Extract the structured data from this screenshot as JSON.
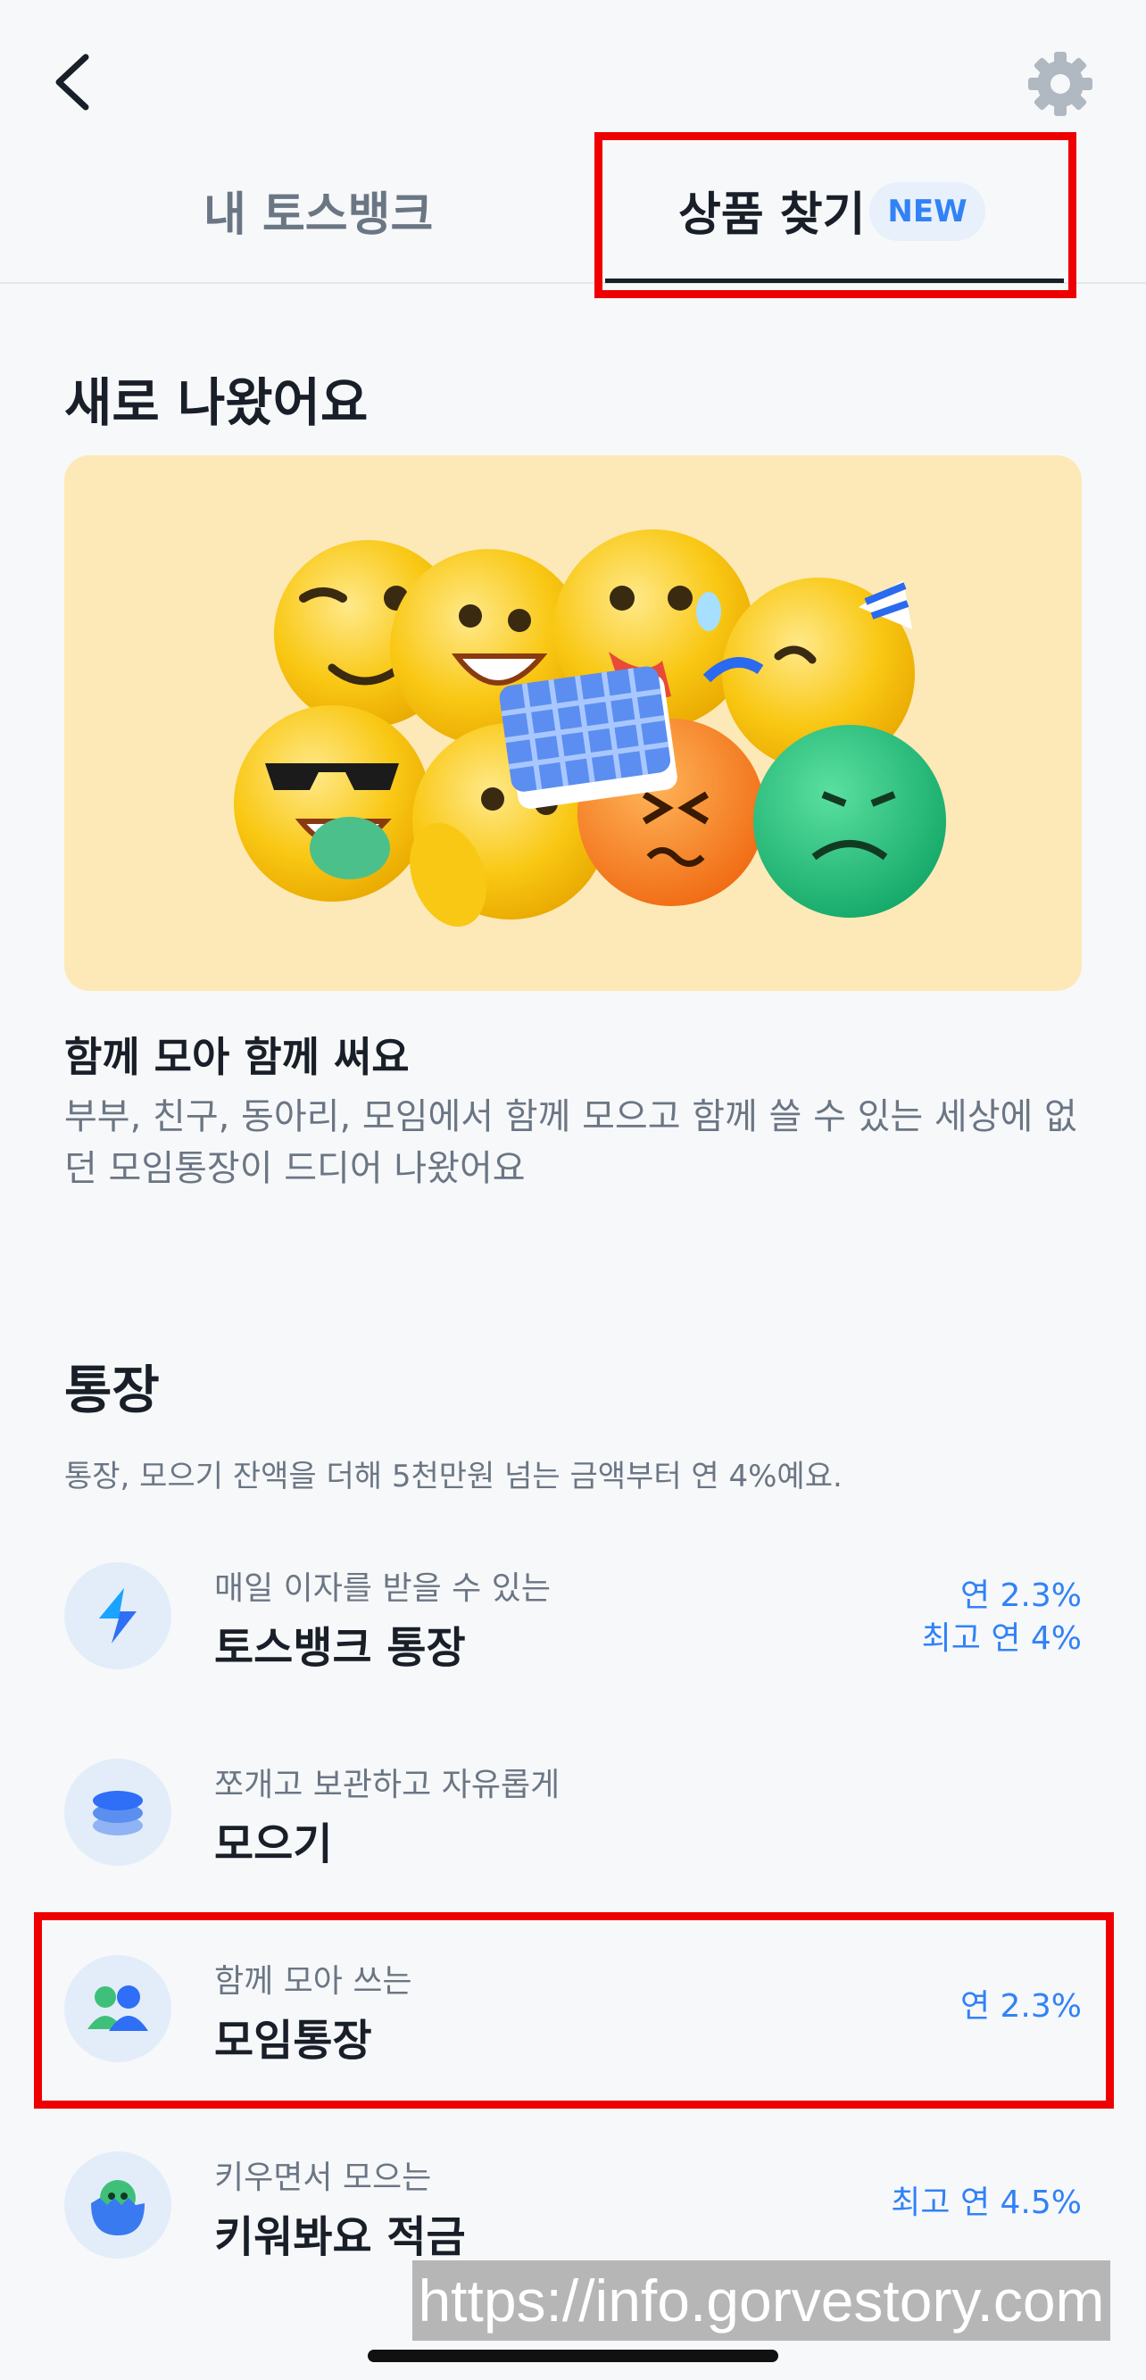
{
  "header": {
    "tabs": [
      {
        "label": "내 토스뱅크",
        "selected": false
      },
      {
        "label": "상품 찾기",
        "selected": true,
        "badge": "NEW"
      }
    ]
  },
  "new_section": {
    "title": "새로 나왔어요",
    "promo": {
      "title": "함께 모아 함께 써요",
      "description": "부부, 친구, 동아리, 모임에서 함께 모으고 함께 쓸 수 있는 세상에 없던 모임통장이 드디어 나왔어요"
    }
  },
  "account_section": {
    "title": "통장",
    "description": "통장, 모으기 잔액을 더해 5천만원 넘는 금액부터 연 4%예요.",
    "items": [
      {
        "subtitle": "매일 이자를 받을 수 있는",
        "title": "토스뱅크 통장",
        "rate_line1": "연 2.3%",
        "rate_line2": "최고 연 4%",
        "icon": "tossbank-logo-icon"
      },
      {
        "subtitle": "쪼개고 보관하고 자유롭게",
        "title": "모으기",
        "rate_line1": "",
        "rate_line2": "",
        "icon": "stack-icon"
      },
      {
        "subtitle": "함께 모아 쓰는",
        "title": "모임통장",
        "rate_line1": "연 2.3%",
        "rate_line2": "",
        "icon": "group-icon"
      },
      {
        "subtitle": "키우면서 모으는",
        "title": "키워봐요 적금",
        "rate_line1": "최고 연 4.5%",
        "rate_line2": "",
        "icon": "egg-chick-icon"
      }
    ]
  },
  "watermark": "https://info.gorvestory.com",
  "colors": {
    "accent": "#3182f6",
    "highlight": "#ef0000",
    "banner": "#fde9b8"
  }
}
